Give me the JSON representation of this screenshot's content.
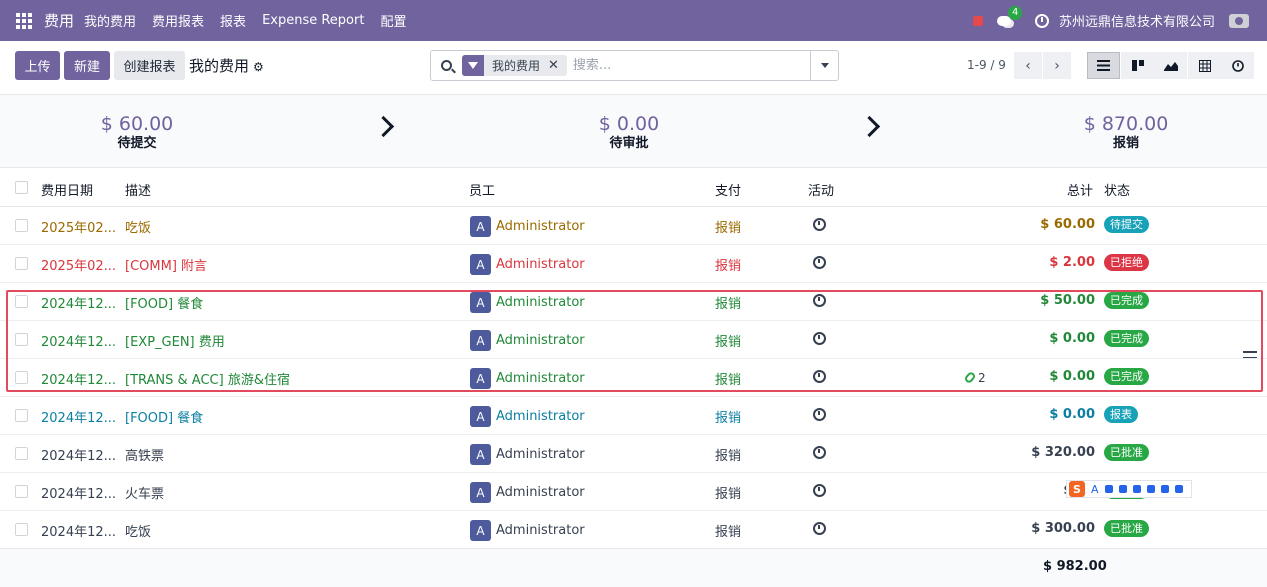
{
  "navbar": {
    "app_name": "费用",
    "menu": [
      "我的费用",
      "费用报表",
      "报表",
      "Expense Report",
      "配置"
    ],
    "chat_count": "4",
    "company": "苏州远鼎信息技术有限公司",
    "accent": "#71639e"
  },
  "control_panel": {
    "upload_label": "上传",
    "new_label": "新建",
    "create_report_label": "创建报表",
    "breadcrumb": "我的费用",
    "search": {
      "facet": "我的费用",
      "facet_remove": "✕",
      "placeholder": "搜索..."
    },
    "pager": "1-9 / 9",
    "pager_prev": "‹",
    "pager_next": "›",
    "views": [
      "list-icon",
      "kanban-icon",
      "graph-icon",
      "pivot-icon",
      "activity-icon"
    ]
  },
  "summary": {
    "to_submit": {
      "amount": "$ 60.00",
      "label": "待提交"
    },
    "to_approve": {
      "amount": "$ 0.00",
      "label": "待审批"
    },
    "to_reimburse": {
      "amount": "$ 870.00",
      "label": "报销"
    }
  },
  "table": {
    "headers": {
      "date": "费用日期",
      "description": "描述",
      "employee": "员工",
      "payment": "支付",
      "activity": "活动",
      "total": "总计",
      "status": "状态"
    },
    "rows": [
      {
        "date": "2025年02...",
        "desc": "吃饭",
        "employee": "Administrator",
        "avatar": "A",
        "payment": "报销",
        "total": "$ 60.00",
        "status": "待提交",
        "status_color": "#17a2b8",
        "text_color": "brown",
        "attachments": ""
      },
      {
        "date": "2025年02...",
        "desc": "[COMM] 附言",
        "employee": "Administrator",
        "avatar": "A",
        "payment": "报销",
        "total": "$ 2.00",
        "status": "已拒绝",
        "status_color": "#dc3545",
        "text_color": "red",
        "attachments": ""
      },
      {
        "date": "2024年12...",
        "desc": "[FOOD] 餐食",
        "employee": "Administrator",
        "avatar": "A",
        "payment": "报销",
        "total": "$ 50.00",
        "status": "已完成",
        "status_color": "#28a745",
        "text_color": "green",
        "attachments": ""
      },
      {
        "date": "2024年12...",
        "desc": "[EXP_GEN] 费用",
        "employee": "Administrator",
        "avatar": "A",
        "payment": "报销",
        "total": "$ 0.00",
        "status": "已完成",
        "status_color": "#28a745",
        "text_color": "green",
        "attachments": ""
      },
      {
        "date": "2024年12...",
        "desc": "[TRANS & ACC] 旅游&住宿",
        "employee": "Administrator",
        "avatar": "A",
        "payment": "报销",
        "total": "$ 0.00",
        "status": "已完成",
        "status_color": "#28a745",
        "text_color": "green",
        "attachments": "2"
      },
      {
        "date": "2024年12...",
        "desc": "[FOOD] 餐食",
        "employee": "Administrator",
        "avatar": "A",
        "payment": "报销",
        "total": "$ 0.00",
        "status": "报表",
        "status_color": "#17a2b8",
        "text_color": "blue",
        "attachments": ""
      },
      {
        "date": "2024年12...",
        "desc": "高铁票",
        "employee": "Administrator",
        "avatar": "A",
        "payment": "报销",
        "total": "$ 320.00",
        "status": "已批准",
        "status_color": "#28a745",
        "text_color": "default",
        "attachments": ""
      },
      {
        "date": "2024年12...",
        "desc": "火车票",
        "employee": "Administrator",
        "avatar": "A",
        "payment": "报销",
        "total": "$ 25",
        "status": "已批准",
        "status_color": "#28a745",
        "text_color": "default",
        "attachments": ""
      },
      {
        "date": "2024年12...",
        "desc": "吃饭",
        "employee": "Administrator",
        "avatar": "A",
        "payment": "报销",
        "total": "$ 300.00",
        "status": "已批准",
        "status_color": "#28a745",
        "text_color": "default",
        "attachments": ""
      }
    ],
    "grand_total": "$ 982.00"
  },
  "ime_toolbar": {
    "logo": "S",
    "mode": "A"
  }
}
